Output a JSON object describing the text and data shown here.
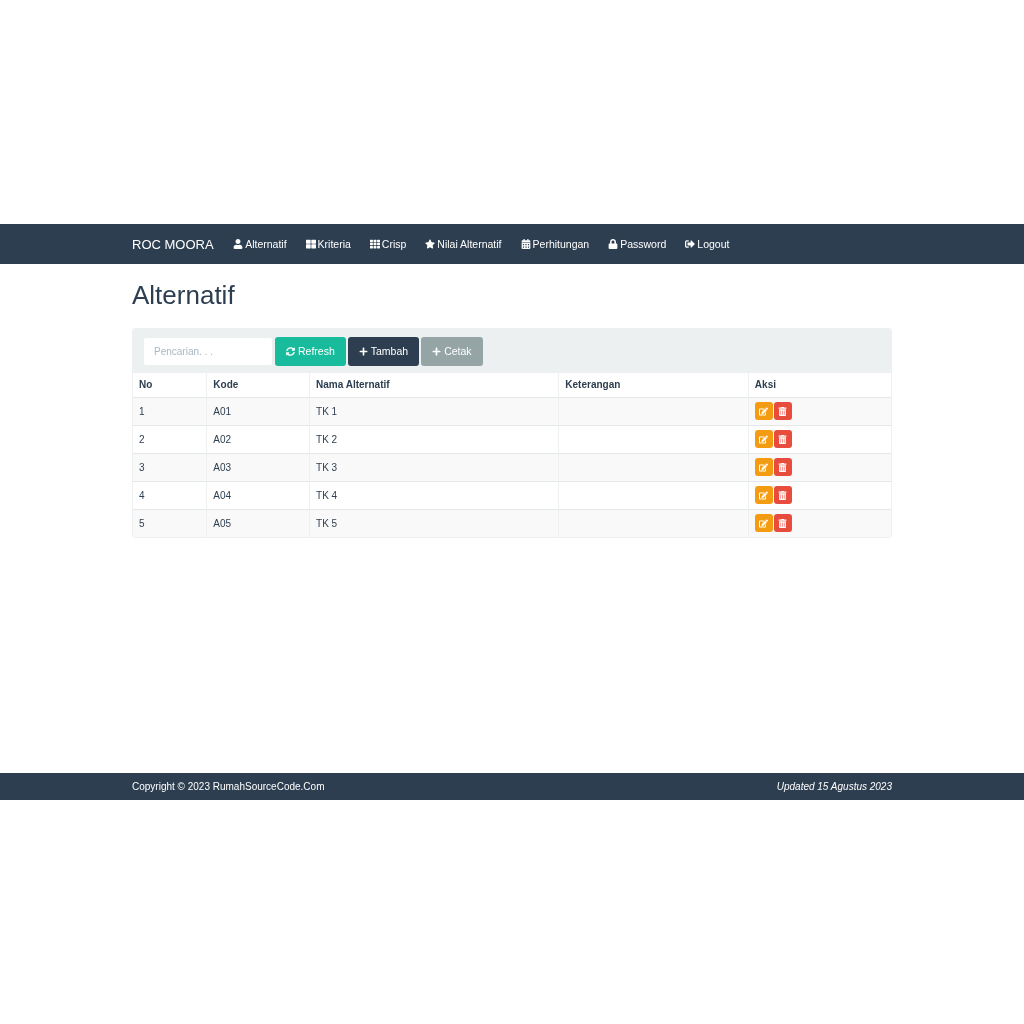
{
  "navbar": {
    "brand": "ROC MOORA",
    "items": [
      {
        "label": "Alternatif"
      },
      {
        "label": "Kriteria"
      },
      {
        "label": "Crisp"
      },
      {
        "label": "Nilai Alternatif"
      },
      {
        "label": "Perhitungan"
      },
      {
        "label": "Password"
      },
      {
        "label": "Logout"
      }
    ]
  },
  "page_title": "Alternatif",
  "toolbar": {
    "search": {
      "placeholder": "Pencarian. . ."
    },
    "buttons": [
      {
        "label": "Refresh",
        "kind": "refresh"
      },
      {
        "label": "Tambah",
        "kind": "add"
      },
      {
        "label": "Cetak",
        "kind": "print"
      }
    ]
  },
  "table": {
    "columns": [
      "No",
      "Kode",
      "Nama Alternatif",
      "Keterangan",
      "Aksi"
    ],
    "rows": [
      {
        "no": "1",
        "kode": "A01",
        "nama": "TK 1"
      },
      {
        "no": "2",
        "kode": "A02",
        "nama": "TK 2"
      },
      {
        "no": "3",
        "kode": "A03",
        "nama": "TK 3"
      },
      {
        "no": "4",
        "kode": "A04",
        "nama": "TK 4"
      },
      {
        "no": "5",
        "kode": "A05",
        "nama": "TK 5"
      }
    ]
  },
  "footer": {
    "copyright": "Copyright © 2023 RumahSourceCode.Com",
    "updated": "Updated 15 Agustus 2023"
  }
}
